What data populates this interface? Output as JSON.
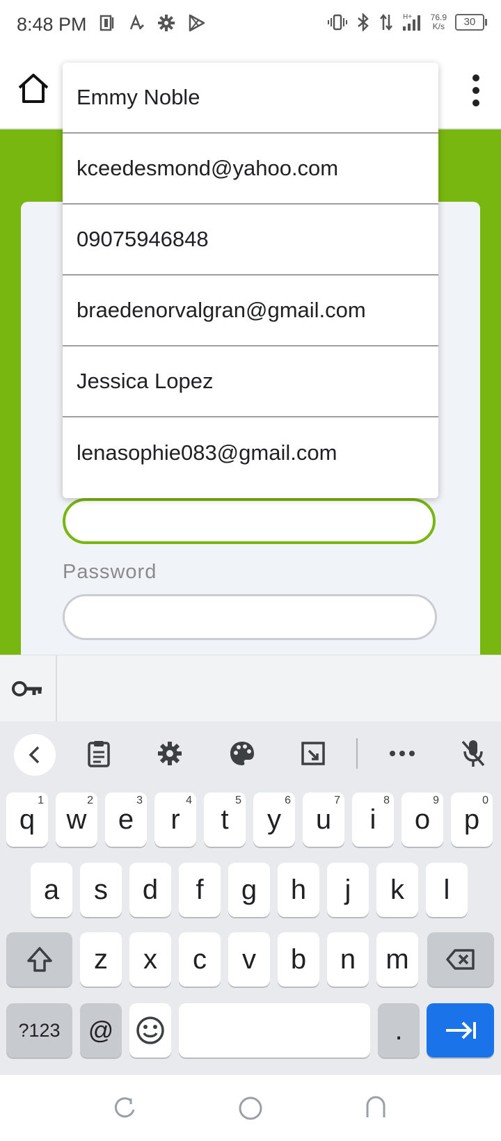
{
  "status_bar": {
    "time": "8:48 PM",
    "net_speed_value": "76.9",
    "net_speed_unit": "K/s",
    "network_type": "H+",
    "battery": "30"
  },
  "form": {
    "password_label": "Password"
  },
  "autofill_suggestions": [
    "Emmy Noble",
    "kceedesmond@yahoo.com",
    "09075946848",
    "braedenorvalgran@gmail.com",
    "Jessica Lopez",
    "lenasophie083@gmail.com"
  ],
  "keyboard": {
    "row1": [
      {
        "k": "q",
        "n": "1"
      },
      {
        "k": "w",
        "n": "2"
      },
      {
        "k": "e",
        "n": "3"
      },
      {
        "k": "r",
        "n": "4"
      },
      {
        "k": "t",
        "n": "5"
      },
      {
        "k": "y",
        "n": "6"
      },
      {
        "k": "u",
        "n": "7"
      },
      {
        "k": "i",
        "n": "8"
      },
      {
        "k": "o",
        "n": "9"
      },
      {
        "k": "p",
        "n": "0"
      }
    ],
    "row2": [
      "a",
      "s",
      "d",
      "f",
      "g",
      "h",
      "j",
      "k",
      "l"
    ],
    "row3": [
      "z",
      "x",
      "c",
      "v",
      "b",
      "n",
      "m"
    ],
    "symbols_label": "?123",
    "at_label": "@",
    "period_label": "."
  },
  "colors": {
    "brand_green": "#78b70f",
    "accent_blue": "#1a73e8"
  }
}
